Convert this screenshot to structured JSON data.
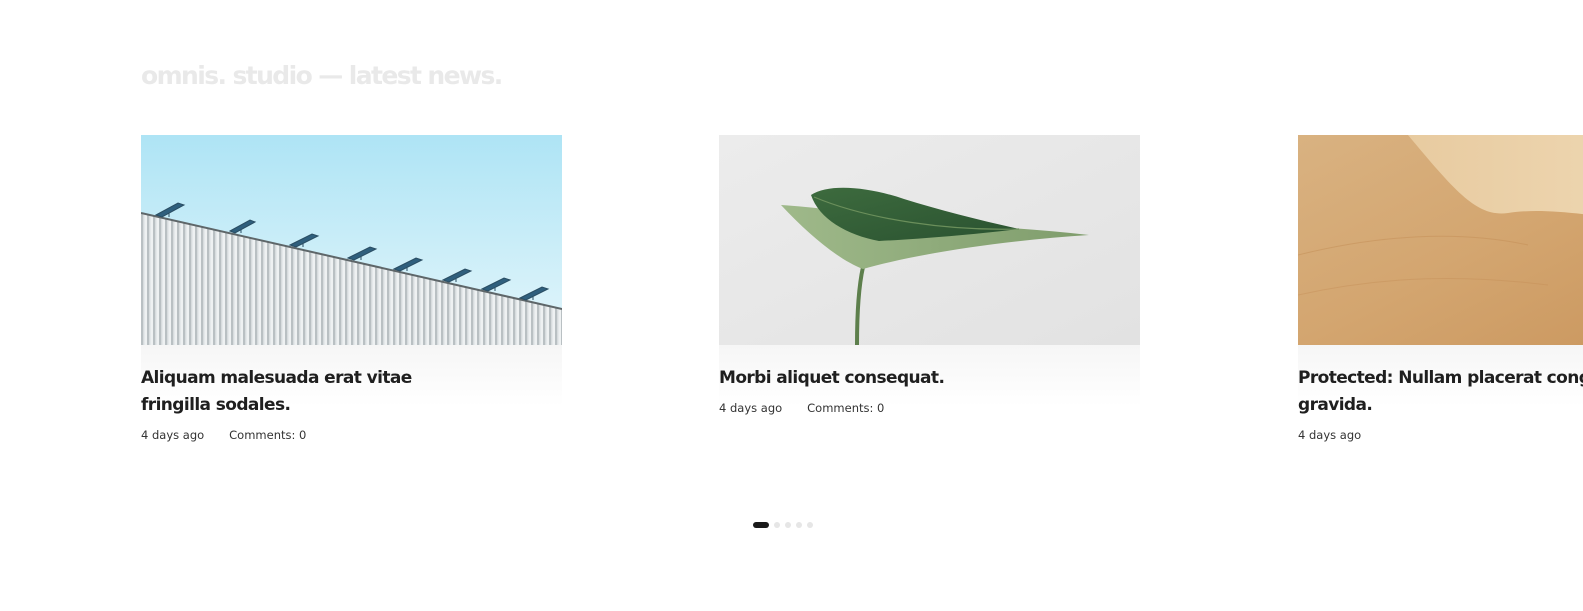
{
  "section": {
    "title": "omnis. studio — latest news."
  },
  "posts": [
    {
      "title": "Aliquam malesuada erat vitae fringilla sodales.",
      "date": "4 days ago",
      "comments": "Comments: 0",
      "image": "solar-panels-roof-image"
    },
    {
      "title": "Morbi aliquet consequat.",
      "date": "4 days ago",
      "comments": "Comments: 0",
      "image": "green-leaf-image"
    },
    {
      "title": "Protected: Nullam placerat cong gravida.",
      "date": "4 days ago",
      "image": "sand-dune-image"
    }
  ],
  "pagination": {
    "pages": 5,
    "active": 1
  },
  "colors": {
    "title_faded": "#e9e9e9",
    "text_dark": "#1f1f1f",
    "dot_active": "#1a1a1a",
    "dot_inactive": "#e6e6e6"
  }
}
